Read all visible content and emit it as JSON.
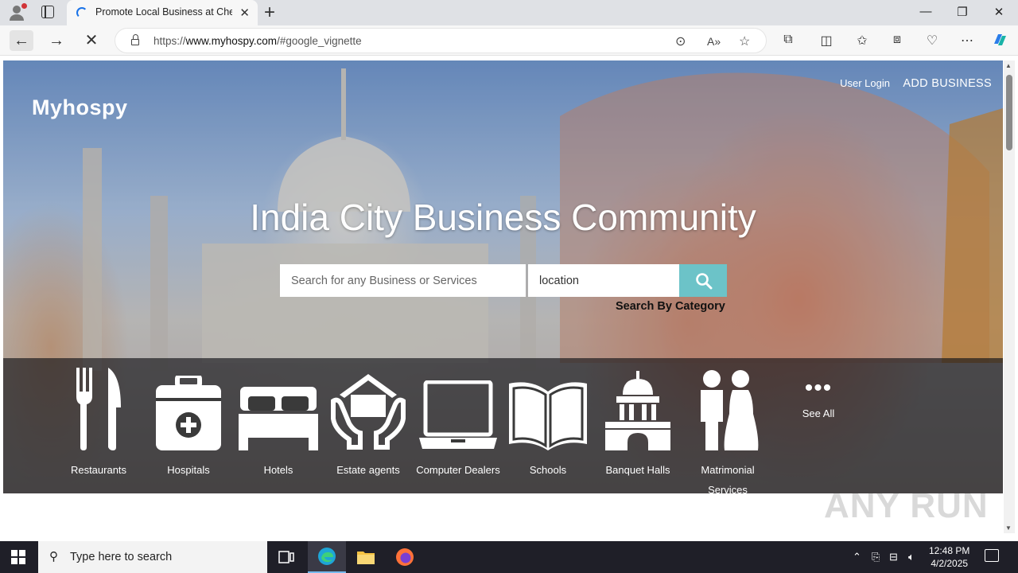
{
  "browser": {
    "tab_title": "Promote Local Business at Cheap",
    "url_prefix": "https://",
    "url_host": "www.myhospy.com",
    "url_path": "/#google_vignette"
  },
  "site": {
    "logo": "Myhospy",
    "user_login": "User Login",
    "add_business": "ADD BUSINESS",
    "headline": "India City Business Community",
    "search_placeholder": "Search for any Business or Services",
    "location_placeholder": "location",
    "search_by_category": "Search By Category",
    "accent_color": "#6cc3c8"
  },
  "categories": [
    {
      "label": "Restaurants",
      "icon": "fork-knife-icon"
    },
    {
      "label": "Hospitals",
      "icon": "medical-kit-icon"
    },
    {
      "label": "Hotels",
      "icon": "bed-icon"
    },
    {
      "label": "Estate agents",
      "icon": "house-hands-icon"
    },
    {
      "label": "Computer Dealers",
      "icon": "laptop-icon"
    },
    {
      "label": "Schools",
      "icon": "open-book-icon"
    },
    {
      "label": "Banquet Halls",
      "icon": "hall-building-icon"
    },
    {
      "label": "Matrimonial Services",
      "icon": "couple-icon"
    }
  ],
  "see_all": "See All",
  "watermark": "ANY RUN",
  "taskbar": {
    "search_placeholder": "Type here to search",
    "time": "12:48 PM",
    "date": "4/2/2025"
  }
}
